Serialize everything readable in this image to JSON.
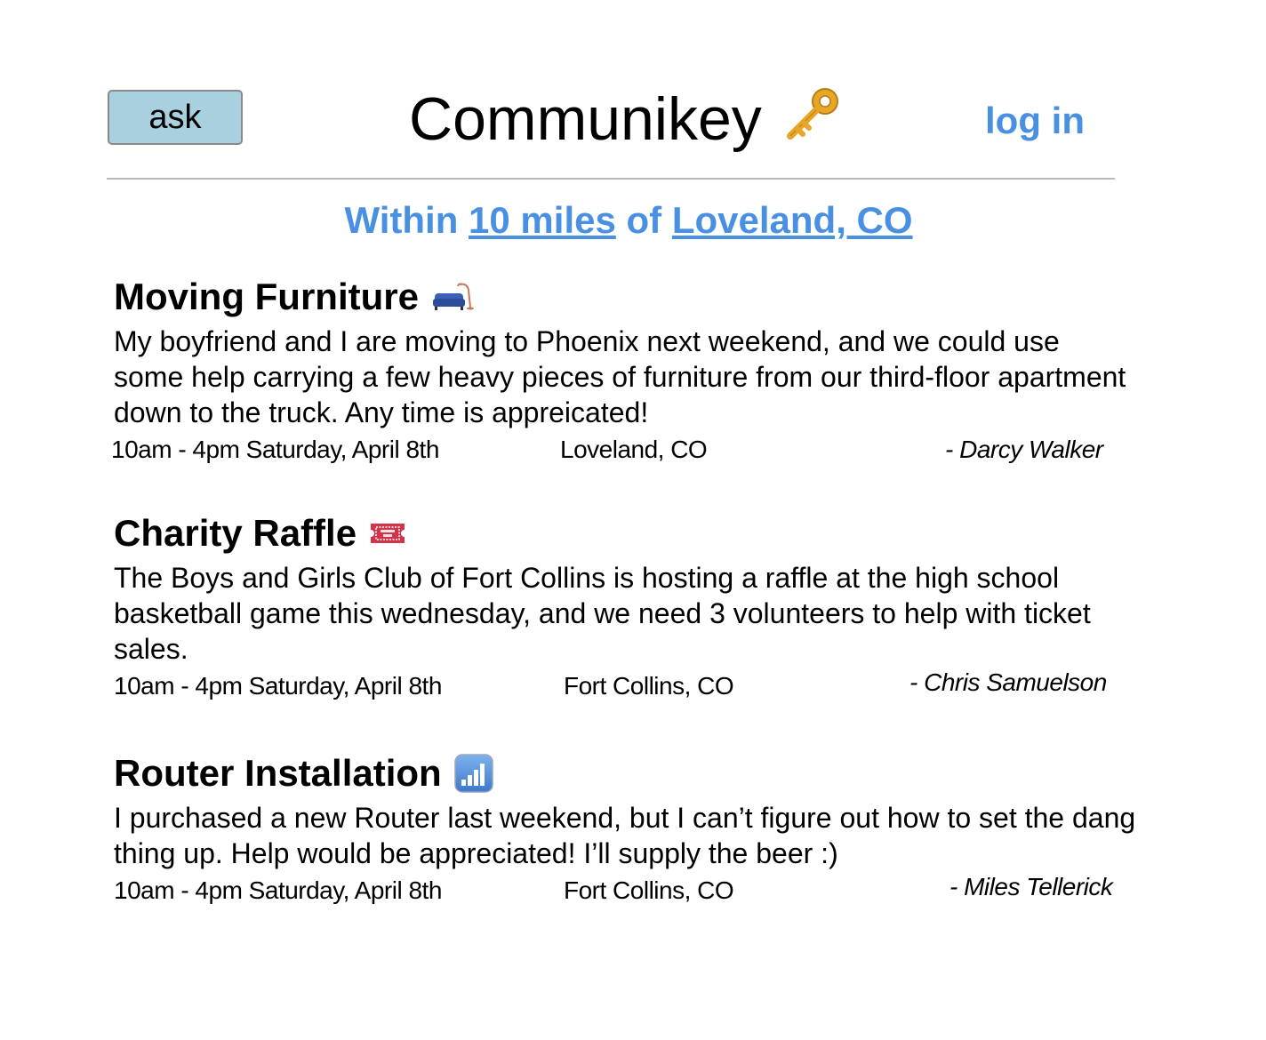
{
  "header": {
    "ask_label": "ask",
    "app_title": "Communikey",
    "login_label": "log in"
  },
  "location_filter": {
    "prefix": "Within ",
    "distance": "10 miles",
    "middle": " of ",
    "place": "Loveland, CO"
  },
  "posts": [
    {
      "title": "Moving Furniture",
      "icon": "couch-icon",
      "body": "My boyfriend and I are moving to Phoenix next weekend, and we could use some help carrying a few heavy pieces of furniture from our third-floor apartment down to the truck. Any time is appreicated!",
      "time": "10am - 4pm Saturday, April 8th",
      "location": "Loveland, CO",
      "author": "- Darcy Walker"
    },
    {
      "title": "Charity Raffle",
      "icon": "ticket-icon",
      "body": "The Boys and Girls Club of Fort Collins is hosting a raffle at the high school basketball game this wednesday, and we need 3 volunteers to help with ticket sales.",
      "time": "10am - 4pm Saturday, April 8th",
      "location": "Fort Collins, CO",
      "author": "- Chris Samuelson"
    },
    {
      "title": "Router Installation",
      "icon": "signal-bars-icon",
      "body": "I purchased a new Router last weekend, but I can’t figure out how to set the dang thing up. Help would be appreciated! I’ll supply the beer :)",
      "time": "10am - 4pm Saturday, April 8th",
      "location": "Fort Collins, CO",
      "author": "- Miles Tellerick"
    }
  ],
  "colors": {
    "accent": "#4a90e2",
    "ask_button_bg": "#a9d0de",
    "ticket_red": "#d0334a",
    "signal_blue": "#5a8fd6"
  }
}
